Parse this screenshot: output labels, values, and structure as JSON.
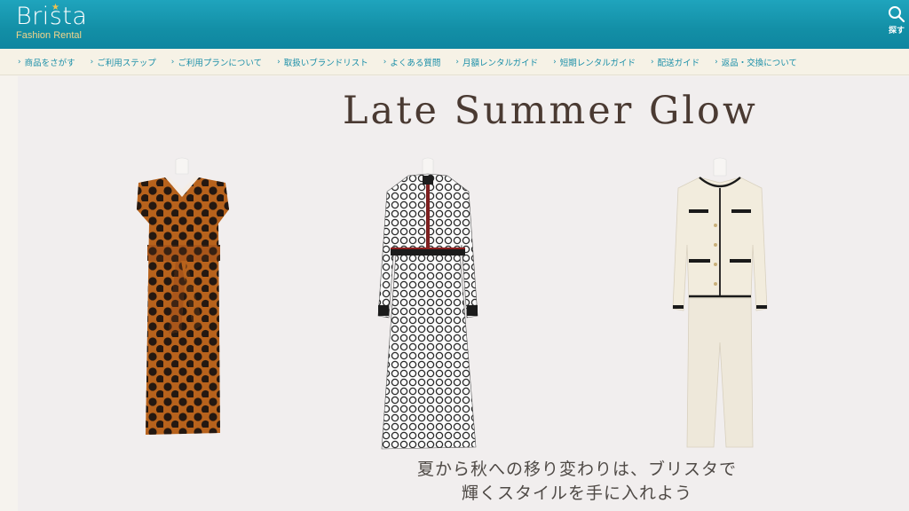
{
  "header": {
    "logo_name": "Brista",
    "logo_sub": "Fashion Rental",
    "search_label": "探す"
  },
  "nav": {
    "items": [
      "商品をさがす",
      "ご利用ステップ",
      "ご利用プランについて",
      "取扱いブランドリスト",
      "よくある質問",
      "月額レンタルガイド",
      "短期レンタルガイド",
      "配送ガイド",
      "返品・交換について"
    ]
  },
  "banner": {
    "headline": "Late Summer Glow",
    "caption_line1": "夏から秋への移り変わりは、ブリスタで",
    "caption_line2": "輝くスタイルを手に入れよう"
  },
  "colors": {
    "header": "#138fa6",
    "nav_bg": "#f6f2e6",
    "nav_text": "#1a8fa8",
    "logo_sub": "#f4d58a",
    "banner_bg": "#f1eeee",
    "headline": "#4a3a32"
  },
  "icons": {
    "search": "search-icon",
    "nav_chevron": "chevron-right-icon"
  }
}
